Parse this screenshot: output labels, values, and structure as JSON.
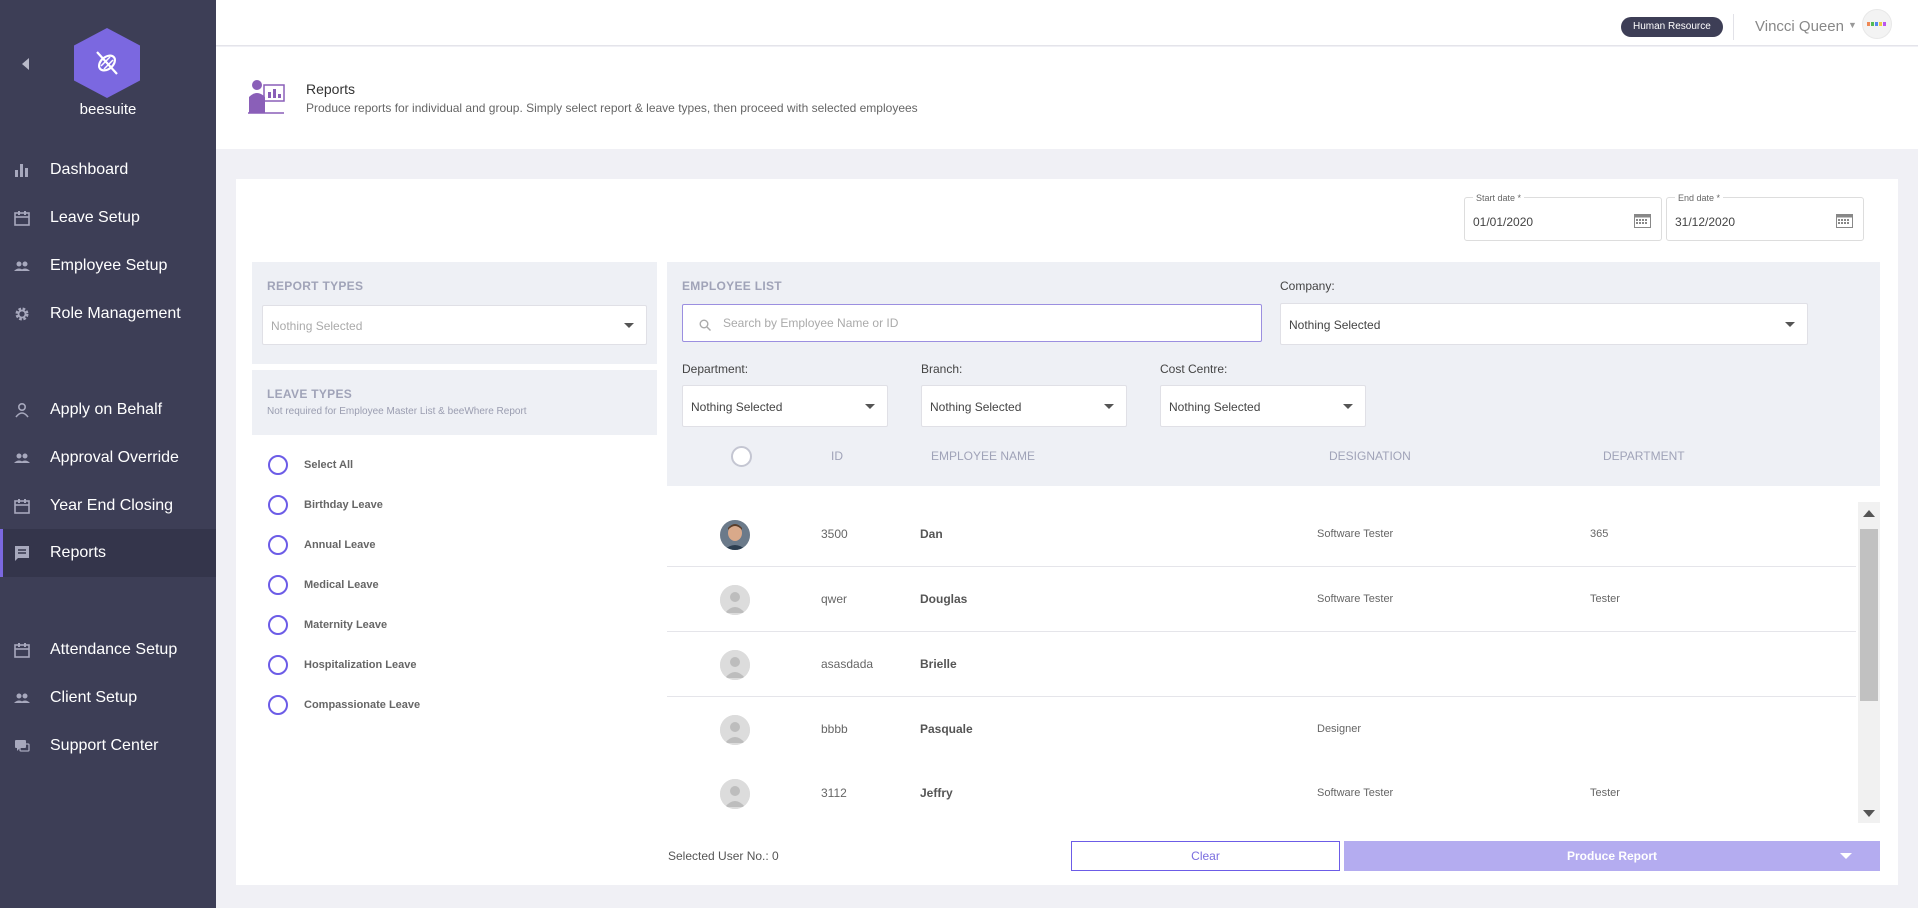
{
  "sidebar": {
    "logo_text": "beesuite",
    "items": [
      {
        "label": "Dashboard",
        "icon": "bar-chart-icon"
      },
      {
        "label": "Leave Setup",
        "icon": "calendar-icon"
      },
      {
        "label": "Employee Setup",
        "icon": "users-icon"
      },
      {
        "label": "Role Management",
        "icon": "gear-icon"
      },
      {
        "label": "Apply on Behalf",
        "icon": "user-icon"
      },
      {
        "label": "Approval Override",
        "icon": "users-icon"
      },
      {
        "label": "Year End Closing",
        "icon": "calendar-icon"
      },
      {
        "label": "Reports",
        "icon": "report-icon",
        "active": true
      },
      {
        "label": "Attendance Setup",
        "icon": "calendar-icon"
      },
      {
        "label": "Client Setup",
        "icon": "users-icon"
      },
      {
        "label": "Support Center",
        "icon": "chat-icon"
      }
    ]
  },
  "header": {
    "role_badge": "Human Resource",
    "user_name": "Vincci Queen"
  },
  "page": {
    "title": "Reports",
    "subtitle": "Produce reports for individual and group. Simply select report & leave types, then proceed with selected employees"
  },
  "dates": {
    "start_label": "Start date *",
    "start_value": "01/01/2020",
    "end_label": "End date *",
    "end_value": "31/12/2020"
  },
  "report_types": {
    "title": "REPORT TYPES",
    "selected": "Nothing Selected"
  },
  "leave_types": {
    "title": "LEAVE TYPES",
    "note": "Not required for Employee Master List & beeWhere Report",
    "items": [
      "Select All",
      "Birthday Leave",
      "Annual Leave",
      "Medical Leave",
      "Maternity Leave",
      "Hospitalization Leave",
      "Compassionate Leave"
    ]
  },
  "employee_list": {
    "title": "EMPLOYEE LIST",
    "search_placeholder": "Search by Employee Name or ID",
    "company_label": "Company:",
    "company_value": "Nothing Selected",
    "department_label": "Department:",
    "department_value": "Nothing Selected",
    "branch_label": "Branch:",
    "branch_value": "Nothing Selected",
    "cost_centre_label": "Cost Centre:",
    "cost_centre_value": "Nothing Selected",
    "columns": [
      "ID",
      "EMPLOYEE NAME",
      "DESIGNATION",
      "DEPARTMENT"
    ],
    "rows": [
      {
        "id": "3500",
        "name": "Dan",
        "designation": "Software Tester",
        "department": "365",
        "photo": true
      },
      {
        "id": "qwer",
        "name": "Douglas",
        "designation": "Software Tester",
        "department": "Tester",
        "photo": false
      },
      {
        "id": "asasdada",
        "name": "Brielle",
        "designation": "",
        "department": "",
        "photo": false
      },
      {
        "id": "bbbb",
        "name": "Pasquale",
        "designation": "Designer",
        "department": "",
        "photo": false
      },
      {
        "id": "3112",
        "name": "Jeffry",
        "designation": "Software Tester",
        "department": "Tester",
        "photo": false
      }
    ]
  },
  "footer": {
    "selected_count_label": "Selected User No.: 0",
    "clear_label": "Clear",
    "produce_label": "Produce Report"
  },
  "colors": {
    "sidebar_bg": "#3d3e56",
    "accent": "#6c5ce7",
    "accent_light": "#b4acf0"
  }
}
